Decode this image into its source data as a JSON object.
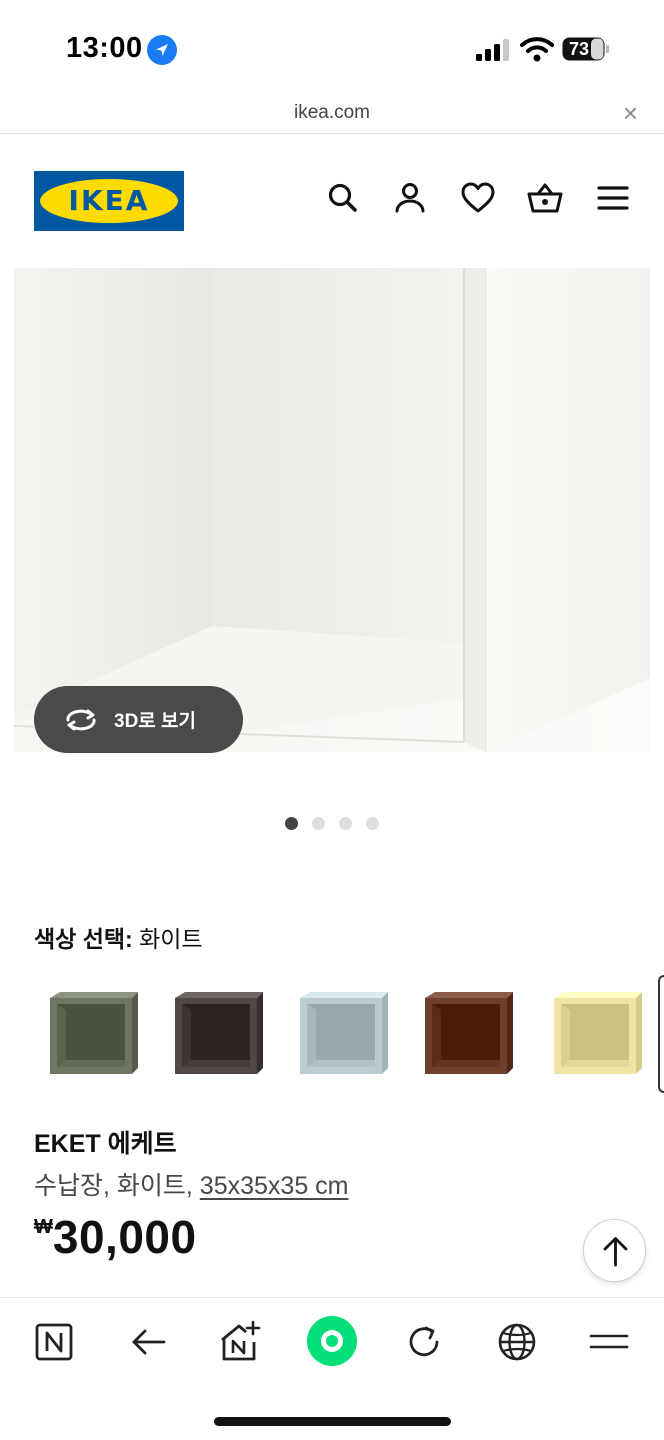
{
  "status_bar": {
    "time": "13:00",
    "battery": "73"
  },
  "url_bar": {
    "domain": "ikea.com",
    "close": "×"
  },
  "header": {
    "logo_text": "IKEA"
  },
  "gallery": {
    "view3d_label": "3D로 보기",
    "dots": 4,
    "active_dot": 0
  },
  "color": {
    "label": "색상 선택:",
    "value": "화이트",
    "swatches": [
      {
        "name": "green",
        "color": "#6e7560"
      },
      {
        "name": "dark-brown",
        "color": "#4f4846"
      },
      {
        "name": "light-blue",
        "color": "#b9ccd0"
      },
      {
        "name": "walnut",
        "color": "#6e3f2c"
      },
      {
        "name": "yellow",
        "color": "#efe4a3"
      }
    ]
  },
  "product": {
    "name": "EKET 에케트",
    "desc_prefix": "수납장, 화이트,",
    "dimension": "35x35x35 cm",
    "currency": "₩",
    "price": "30,000"
  }
}
